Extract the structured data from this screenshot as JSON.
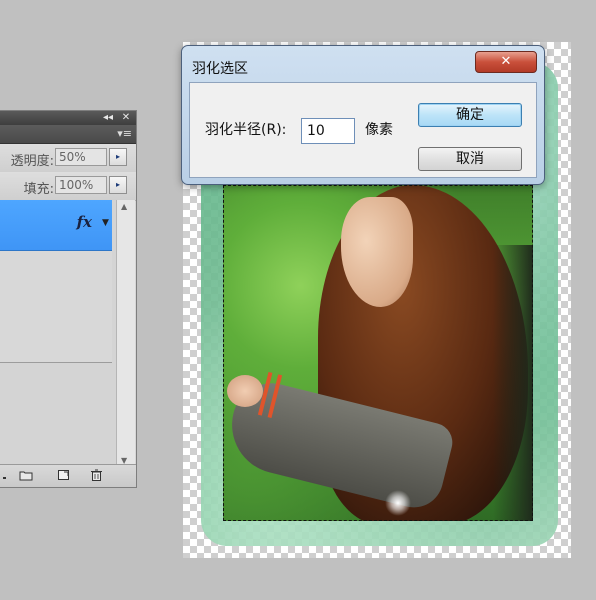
{
  "dialog": {
    "title": "羽化选区",
    "close_glyph": "✕",
    "radius_label": "羽化半径(R):",
    "radius_value": "10",
    "unit": "像素",
    "ok_label": "确定",
    "cancel_label": "取消"
  },
  "layers_panel": {
    "collapse_glyph": "◂◂",
    "close_glyph": "✕",
    "menu_glyph": "▾≡",
    "opacity_label": "透明度:",
    "opacity_value": "50%",
    "fill_label": "填充:",
    "fill_value": "100%",
    "stepper_glyph": "▸",
    "fx_label": "fx",
    "fx_arrow_glyph": "▼",
    "footer_icons": [
      "layer-style-icon",
      "new-group-icon",
      "new-layer-icon",
      "trash-icon"
    ]
  },
  "colors": {
    "selected_layer": "#4ea6ff",
    "close_button": "#c9503b",
    "ok_button": "#bde4f8"
  }
}
